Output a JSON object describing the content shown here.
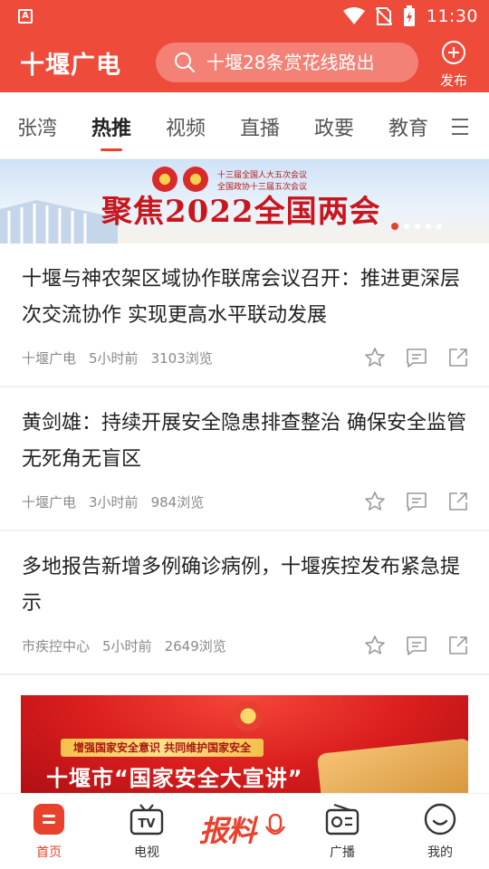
{
  "status_bar": {
    "time": "11:30",
    "app_badge": "A"
  },
  "header": {
    "logo": "十堰广电",
    "search_placeholder": "十堰28条赏花线路出",
    "publish_label": "发布"
  },
  "tabs": [
    {
      "label": "张湾",
      "active": false
    },
    {
      "label": "热推",
      "active": true
    },
    {
      "label": "视频",
      "active": false
    },
    {
      "label": "直播",
      "active": false
    },
    {
      "label": "政要",
      "active": false
    },
    {
      "label": "教育",
      "active": false
    }
  ],
  "banner_top": {
    "line1": "十三届全国人大五次会议",
    "line2": "全国政协十三届五次会议",
    "title": "聚焦2022全国两会"
  },
  "articles": [
    {
      "title": "十堰与神农架区域协作联席会议召开：推进更深层次交流协作 实现更高水平联动发展",
      "source": "十堰广电",
      "time": "5小时前",
      "views": "3103浏览"
    },
    {
      "title": "黄剑雄：持续开展安全隐患排查整治 确保安全监管无死角无盲区",
      "source": "十堰广电",
      "time": "3小时前",
      "views": "984浏览"
    },
    {
      "title": "多地报告新增多例确诊病例，十堰疾控发布紧急提示",
      "source": "市疾控中心",
      "time": "5小时前",
      "views": "2649浏览"
    }
  ],
  "banner_bottom": {
    "strip": "增强国家安全意识 共同维护国家安全",
    "title": "十堰市“国家安全大宣讲”"
  },
  "bottom_nav": [
    {
      "label": "首页",
      "icon": "home-icon",
      "active": true
    },
    {
      "label": "电视",
      "icon": "tv-icon",
      "active": false
    },
    {
      "label": "报料",
      "icon": "report-icon",
      "active": false
    },
    {
      "label": "广播",
      "icon": "radio-icon",
      "active": false
    },
    {
      "label": "我的",
      "icon": "profile-icon",
      "active": false
    }
  ],
  "colors": {
    "brand": "#ee4b3b",
    "accent": "#e8412c"
  }
}
